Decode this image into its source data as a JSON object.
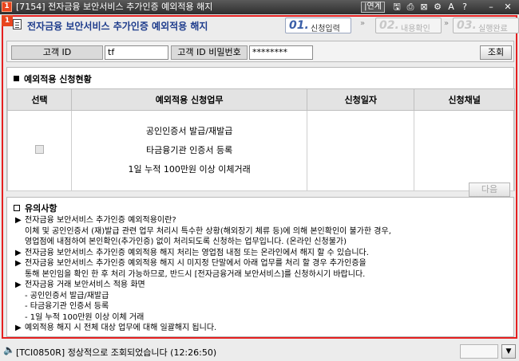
{
  "window": {
    "badge": "1",
    "title": "[7154] 전자금융 보안서비스 추가인증 예외적용 해지",
    "link_button": "|연계",
    "icons": [
      "save-icon",
      "printer-icon",
      "close-box-icon",
      "settings-icon",
      "font-size-icon",
      "help-icon",
      "minimize-icon",
      "close-icon"
    ]
  },
  "header": {
    "badge": "1",
    "title": "전자금융 보안서비스 추가인증 예외적용 해지",
    "steps": [
      {
        "num": "01.",
        "label": "신청입력"
      },
      {
        "num": "02.",
        "label": "내용확인"
      },
      {
        "num": "03.",
        "label": "실행완료"
      }
    ],
    "step_separator": "»"
  },
  "search": {
    "customer_id_label": "고객 ID",
    "customer_id_value": "tf",
    "password_label": "고객 ID 비밀번호",
    "password_value": "********",
    "search_button": "조회"
  },
  "status_section": {
    "title": "예외적용 신청현황",
    "columns": [
      "선택",
      "예외적용 신청업무",
      "신청일자",
      "신청채널"
    ],
    "row": {
      "selected": false,
      "tasks": [
        "공인인증서 발급/재발급",
        "타금융기관 인증서 등록",
        "1일 누적 100만원 이상 이체거래"
      ],
      "date": "",
      "channel": ""
    },
    "next_button": "다음"
  },
  "notes": {
    "title": "유의사항",
    "lines": [
      {
        "bullet": "▶",
        "text": "전자금융 보안서비스 추가인증 예외적용이란?"
      },
      {
        "bullet": "",
        "text": "이체 및 공인인증서 (재)발급 관련 업무 처리시 특수한 상황(해외장기 체류 등)에 의해  본인확인이 불가한 경우,"
      },
      {
        "bullet": "",
        "text": "영업점에 내점하여 본인확인(추가인증) 없이 처리되도록 신청하는 업무입니다. (온라인 신청불가)"
      },
      {
        "bullet": "▶",
        "text": "전자금융 보안서비스 추가인증 예외적용 해지 처리는 영업점 내점 또는 온라인에서 해지 할 수 있습니다."
      },
      {
        "bullet": "▶",
        "text": "전자금융 보안서비스 추가인증 예외적용 해지 시 미지정 단말에서 아래 업무를 처리 할 경우 추가인증을"
      },
      {
        "bullet": "",
        "text": "통해 본인임을 확인 한 후 처리 가능하므로, 반드시 [전자금융거래 보안서비스]를 신청하시기 바랍니다."
      },
      {
        "bullet": "▶",
        "text": "전자금융 거래 보안서비스 적용 화면"
      },
      {
        "bullet": "",
        "text": " - 공인인증서 발급/재발급"
      },
      {
        "bullet": "",
        "text": " - 타금융기관 인증서 등록"
      },
      {
        "bullet": "",
        "text": " - 1일 누적 100만원 이상 이체 거래"
      },
      {
        "bullet": "▶",
        "text": "예외적용 해지 시 전체 대상 업무에 대해 일괄해지 됩니다."
      }
    ]
  },
  "statusbar": {
    "message": "[TCI0850R] 정상적으로 조회되었습니다 (12:26:50)"
  }
}
